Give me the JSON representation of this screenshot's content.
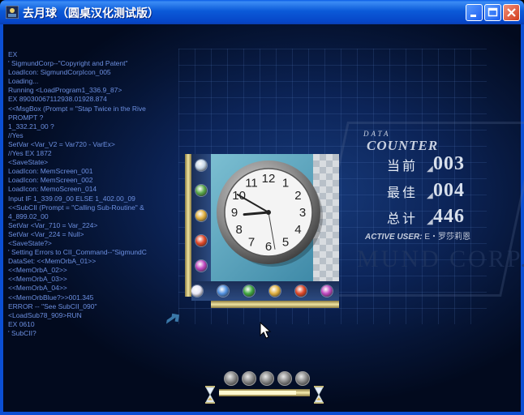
{
  "window": {
    "title": "去月球（圆桌汉化测试版）",
    "controls": [
      "minimize",
      "maximize",
      "close"
    ]
  },
  "code_lines": [
    "EX",
    "' SigmundCorp--\"Copyright and Patent\"",
    "LoadIcon: SigmundCorpIcon_005",
    "Loading...",
    "Running <LoadProgram1_336.9_87>",
    "EX 89030067112938.01928.874",
    "<<MsgBox (Prompt = \"Stap Twice in the Rive",
    "PROMPT ?",
    "  1_332.21_00 ?",
    "//Yes",
    "SetVar <Var_V2 = Var720 - VarEx>",
    "  //Yes    EX 1872",
    "<SaveState>",
    "LoadIcon: MemScreen_001",
    "LoadIcon: MemScreen_002",
    "LoadIcon: MemoScreen_014",
    "Input IF 1_339.09_00 ELSE 1_402.00_09",
    "<<SubCII (Prompt = \"Calling Sub-Routine\" &",
    "  4_899.02_00",
    "SetVar <Var_710 = Var_224>",
    "SetVar <Var_224 = Null>",
    "<SaveState?>",
    "' Setting Errors to CII_Command--\"SigmundC",
    "DataSet: <<MemOrbA_01>>",
    "  <<MemOrbA_02>>",
    "  <<MemOrbA_03>>",
    "  <<MemOrbA_04>>",
    "  <<MemOrbBlue?>>001.345",
    "ERROR -- \"See SubCII_090\"",
    "<LoadSub78_909>RUN",
    "EX 0610",
    "' SubCII?"
  ],
  "watermark": "MUND CORP.",
  "counter": {
    "data_label": "DATA",
    "counter_label": "COUNTER",
    "rows": [
      {
        "label": "当前",
        "value": "003"
      },
      {
        "label": "最佳",
        "value": "004"
      },
      {
        "label": "总计",
        "value": "446"
      }
    ],
    "active_user_label": "ACTIVE USER:",
    "active_user_value": "E・罗莎莉恩"
  },
  "board": {
    "left_orbs": [
      "#c8d8e8",
      "#5aa848",
      "#e0b040",
      "#e04828",
      "#c048c0"
    ],
    "bottom_orbs": [
      "#e8e8f8",
      "#5090e0",
      "#40a840",
      "#e0b040",
      "#e04828",
      "#c048c0"
    ]
  },
  "clock": {
    "hour": 8,
    "minute": 50,
    "second": 22
  },
  "timer": {
    "knobs": 5,
    "progress": 0.85
  },
  "icons": [
    "app-icon",
    "minimize-icon",
    "maximize-icon",
    "close-icon",
    "clock-icon",
    "cursor-icon",
    "arrow-icon",
    "hourglass-icon",
    "orb-icon"
  ]
}
